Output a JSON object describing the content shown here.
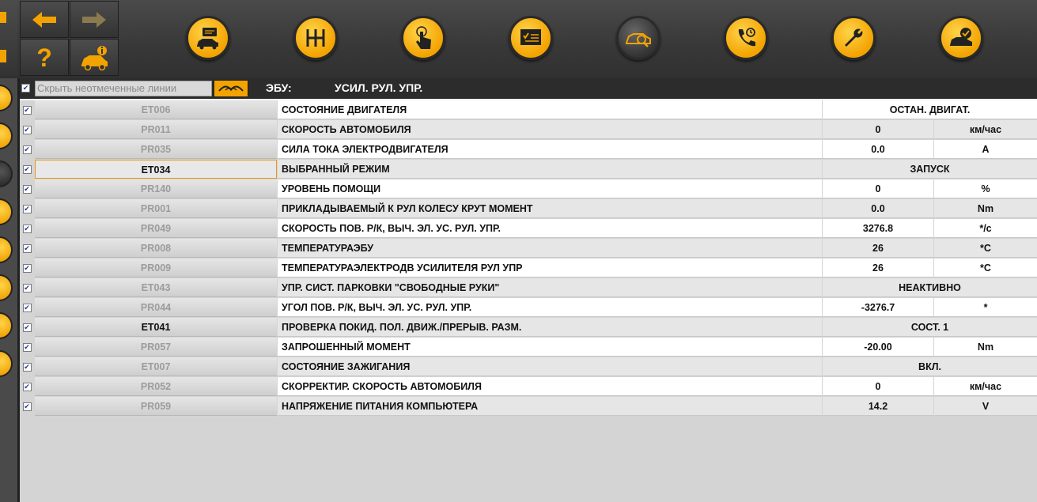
{
  "toolbar": {
    "nav_buttons": [
      {
        "icon": "arrow-left-icon"
      },
      {
        "icon": "arrow-right-icon"
      },
      {
        "icon": "help-icon",
        "label": "?"
      },
      {
        "icon": "vehicle-info-icon"
      }
    ],
    "main_buttons": [
      {
        "icon": "car-message-icon"
      },
      {
        "icon": "gearbox-icon"
      },
      {
        "icon": "touch-icon"
      },
      {
        "icon": "checklist-icon"
      },
      {
        "icon": "car-diagnostic-icon",
        "active": true
      },
      {
        "icon": "phone-support-icon"
      },
      {
        "icon": "wrench-icon"
      },
      {
        "icon": "car-check-icon"
      }
    ]
  },
  "header": {
    "hide_unchecked_label": "Скрыть неотмеченные линии",
    "ecu_label": "ЭБУ:",
    "ecu_name": "УСИЛ. РУЛ. УПР."
  },
  "colors": {
    "accent": "#f3a300",
    "selected_border": "#e39a1a"
  },
  "rows": [
    {
      "code": "ET006",
      "name": "СОСТОЯНИЕ ДВИГАТЕЛЯ",
      "value": "ОСТАН. ДВИГАТ.",
      "unit": ""
    },
    {
      "code": "PR011",
      "name": "СКОРОСТЬ АВТОМОБИЛЯ",
      "value": "0",
      "unit": "км/час"
    },
    {
      "code": "PR035",
      "name": "СИЛА ТОКА ЭЛЕКТРОДВИГАТЕЛЯ",
      "value": "0.0",
      "unit": "A"
    },
    {
      "code": "ET034",
      "name": "ВЫБРАННЫЙ РЕЖИМ",
      "value": "ЗАПУСК",
      "unit": ""
    },
    {
      "code": "PR140",
      "name": "УРОВЕНЬ ПОМОЩИ",
      "value": "0",
      "unit": "%"
    },
    {
      "code": "PR001",
      "name": "ПРИКЛАДЫВАЕМЫЙ К РУЛ КОЛЕСУ КРУТ МОМЕНТ",
      "value": "0.0",
      "unit": "Nm"
    },
    {
      "code": "PR049",
      "name": "СКОРОСТЬ ПОВ. Р/К, ВЫЧ. ЭЛ. УС. РУЛ. УПР.",
      "value": "3276.8",
      "unit": "*/c"
    },
    {
      "code": "PR008",
      "name": "ТЕМПЕРАТУРАЭБУ",
      "value": "26",
      "unit": "*C"
    },
    {
      "code": "PR009",
      "name": "ТЕМПЕРАТУРАЭЛЕКТРОДВ УСИЛИТЕЛЯ РУЛ УПР",
      "value": "26",
      "unit": "*C"
    },
    {
      "code": "ET043",
      "name": "УПР. СИСТ. ПАРКОВКИ \"СВОБОДНЫЕ РУКИ\"",
      "value": "НЕАКТИВНО",
      "unit": ""
    },
    {
      "code": "PR044",
      "name": "УГОЛ ПОВ. Р/К, ВЫЧ. ЭЛ. УС. РУЛ. УПР.",
      "value": "-3276.7",
      "unit": "*"
    },
    {
      "code": "ET041",
      "name": "ПРОВЕРКА ПОКИД. ПОЛ. ДВИЖ./ПРЕРЫВ. РАЗМ.",
      "value": "СОСТ. 1",
      "unit": ""
    },
    {
      "code": "PR057",
      "name": "ЗАПРОШЕННЫЙ МОМЕНТ",
      "value": "-20.00",
      "unit": "Nm"
    },
    {
      "code": "ET007",
      "name": "СОСТОЯНИЕ ЗАЖИГАНИЯ",
      "value": "ВКЛ.",
      "unit": ""
    },
    {
      "code": "PR052",
      "name": "СКОРРЕКТИР. СКОРОСТЬ АВТОМОБИЛЯ",
      "value": "0",
      "unit": "км/час"
    },
    {
      "code": "PR059",
      "name": "НАПРЯЖЕНИЕ ПИТАНИЯ КОМПЬЮТЕРА",
      "value": "14.2",
      "unit": "V"
    }
  ]
}
